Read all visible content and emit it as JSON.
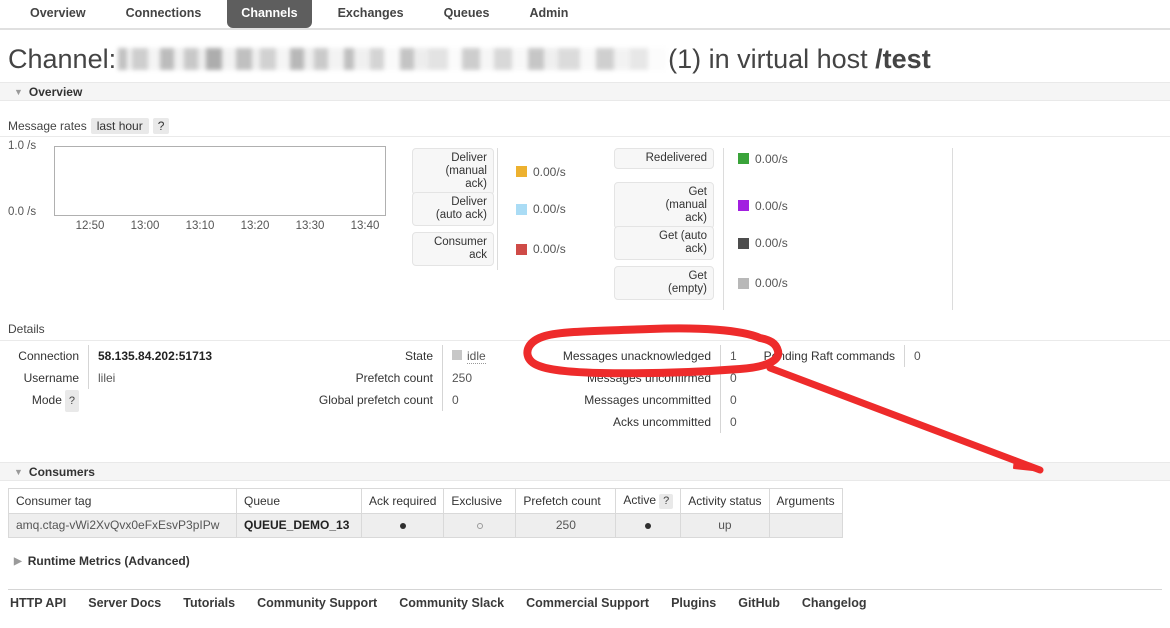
{
  "nav": {
    "tabs": [
      {
        "label": "Overview",
        "active": false
      },
      {
        "label": "Connections",
        "active": false
      },
      {
        "label": "Channels",
        "active": true
      },
      {
        "label": "Exchanges",
        "active": false
      },
      {
        "label": "Queues",
        "active": false
      },
      {
        "label": "Admin",
        "active": false
      }
    ]
  },
  "title": {
    "prefix": "Channel:",
    "redacted_name": "",
    "suffix": "(1) in virtual host ",
    "vhost": "/test"
  },
  "overview_section": {
    "label": "Overview",
    "triangle": "expanded"
  },
  "message_rates": {
    "label": "Message rates",
    "period": "last hour",
    "help": "?"
  },
  "chart_data": {
    "type": "line",
    "title": "Message rates",
    "xlabel": "",
    "ylabel": "/s",
    "ylim": [
      0.0,
      1.0
    ],
    "ytick_labels": [
      "1.0 /s",
      "0.0 /s"
    ],
    "xtick_labels": [
      "12:50",
      "13:00",
      "13:10",
      "13:20",
      "13:30",
      "13:40"
    ],
    "grid": false,
    "legend_position": "right",
    "series": [
      {
        "name": "Deliver (manual ack)",
        "value": "0.00/s",
        "color": "#edb12f",
        "values": []
      },
      {
        "name": "Deliver (auto ack)",
        "value": "0.00/s",
        "color": "#aadcf5",
        "values": []
      },
      {
        "name": "Consumer ack",
        "value": "0.00/s",
        "color": "#cf4b47",
        "values": []
      },
      {
        "name": "Redelivered",
        "value": "0.00/s",
        "color": "#3aa33a",
        "values": []
      },
      {
        "name": "Get (manual ack)",
        "value": "0.00/s",
        "color": "#a21fe0",
        "values": []
      },
      {
        "name": "Get (auto ack)",
        "value": "0.00/s",
        "color": "#4d4d4d",
        "values": []
      },
      {
        "name": "Get (empty)",
        "value": "0.00/s",
        "color": "#b8b8b8",
        "values": []
      }
    ]
  },
  "legend_left": [
    {
      "name": "Deliver\n(manual\nack)",
      "value": "0.00/s",
      "color": "#edb12f"
    },
    {
      "name": "Deliver\n(auto ack)",
      "value": "0.00/s",
      "color": "#aadcf5"
    },
    {
      "name": "Consumer\nack",
      "value": "0.00/s",
      "color": "#cf4b47"
    }
  ],
  "legend_right": [
    {
      "name": "Redelivered",
      "value": "0.00/s",
      "color": "#3aa33a"
    },
    {
      "name": "Get\n(manual\nack)",
      "value": "0.00/s",
      "color": "#a21fe0"
    },
    {
      "name": "Get (auto\nack)",
      "value": "0.00/s",
      "color": "#4d4d4d"
    },
    {
      "name": "Get\n(empty)",
      "value": "0.00/s",
      "color": "#b8b8b8"
    }
  ],
  "details": {
    "label": "Details",
    "left": [
      {
        "key": "Connection",
        "value": "58.135.84.202:51713",
        "style": "bold"
      },
      {
        "key": "Username",
        "value": "lilei",
        "style": "normal"
      },
      {
        "key": "Mode",
        "value": "",
        "style": "normal",
        "help": "?"
      }
    ],
    "mid": [
      {
        "key": "State",
        "value": "idle",
        "style": "state"
      },
      {
        "key": "Prefetch count",
        "value": "250",
        "style": "normal"
      },
      {
        "key": "Global prefetch count",
        "value": "0",
        "style": "normal"
      }
    ],
    "right": [
      {
        "key": "Messages unacknowledged",
        "value": "1",
        "style": "normal"
      },
      {
        "key": "Messages unconfirmed",
        "value": "0",
        "style": "normal"
      },
      {
        "key": "Messages uncommitted",
        "value": "0",
        "style": "normal"
      },
      {
        "key": "Acks uncommitted",
        "value": "0",
        "style": "normal"
      }
    ],
    "far_right": [
      {
        "key": "Pending Raft commands",
        "value": "0",
        "style": "normal"
      }
    ]
  },
  "consumers_section": {
    "label": "Consumers",
    "triangle": "expanded"
  },
  "consumers_table": {
    "columns": [
      "Consumer tag",
      "Queue",
      "Ack required",
      "Exclusive",
      "Prefetch count",
      "Active",
      "Activity status",
      "Arguments"
    ],
    "active_help": "?",
    "rows": [
      {
        "consumer_tag": "amq.ctag-vWi2XvQvx0eFxEsvP3pIPw",
        "queue": "QUEUE_DEMO_13",
        "ack_required": "filled",
        "exclusive": "empty",
        "prefetch_count": "250",
        "active": "filled",
        "activity_status": "up",
        "arguments": ""
      }
    ]
  },
  "runtime_metrics_section": {
    "label": "Runtime Metrics (Advanced)",
    "triangle": "collapsed"
  },
  "footer": {
    "links": [
      "HTTP API",
      "Server Docs",
      "Tutorials",
      "Community Support",
      "Community Slack",
      "Commercial Support",
      "Plugins",
      "GitHub",
      "Changelog"
    ]
  },
  "annotation": {
    "color": "#ee2b2b",
    "shape": "ellipse-with-arrow",
    "target": "Messages unacknowledged = 1"
  }
}
